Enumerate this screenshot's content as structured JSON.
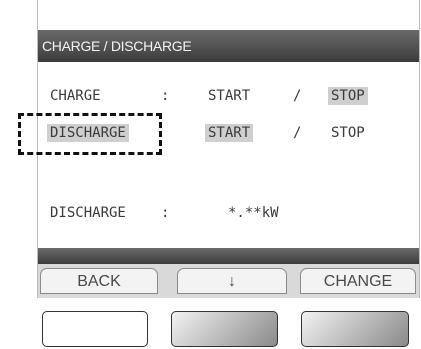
{
  "screen": {
    "title": "CHARGE / DISCHARGE",
    "rows": [
      {
        "label": "CHARGE",
        "sep": ":",
        "start": "START",
        "slash": "/",
        "stop": "STOP"
      },
      {
        "label": "DISCHARGE",
        "start": "START",
        "slash": "/",
        "stop": "STOP"
      }
    ],
    "status": {
      "label": "DISCHARGE",
      "sep": ":",
      "value": "*.**kW"
    }
  },
  "softkeys": {
    "back": "BACK",
    "down": "↓",
    "change": "CHANGE"
  },
  "colors": {
    "titlebar": "#4a4a4a",
    "highlight": "#cfcfcf",
    "text": "#3a3a3a"
  }
}
